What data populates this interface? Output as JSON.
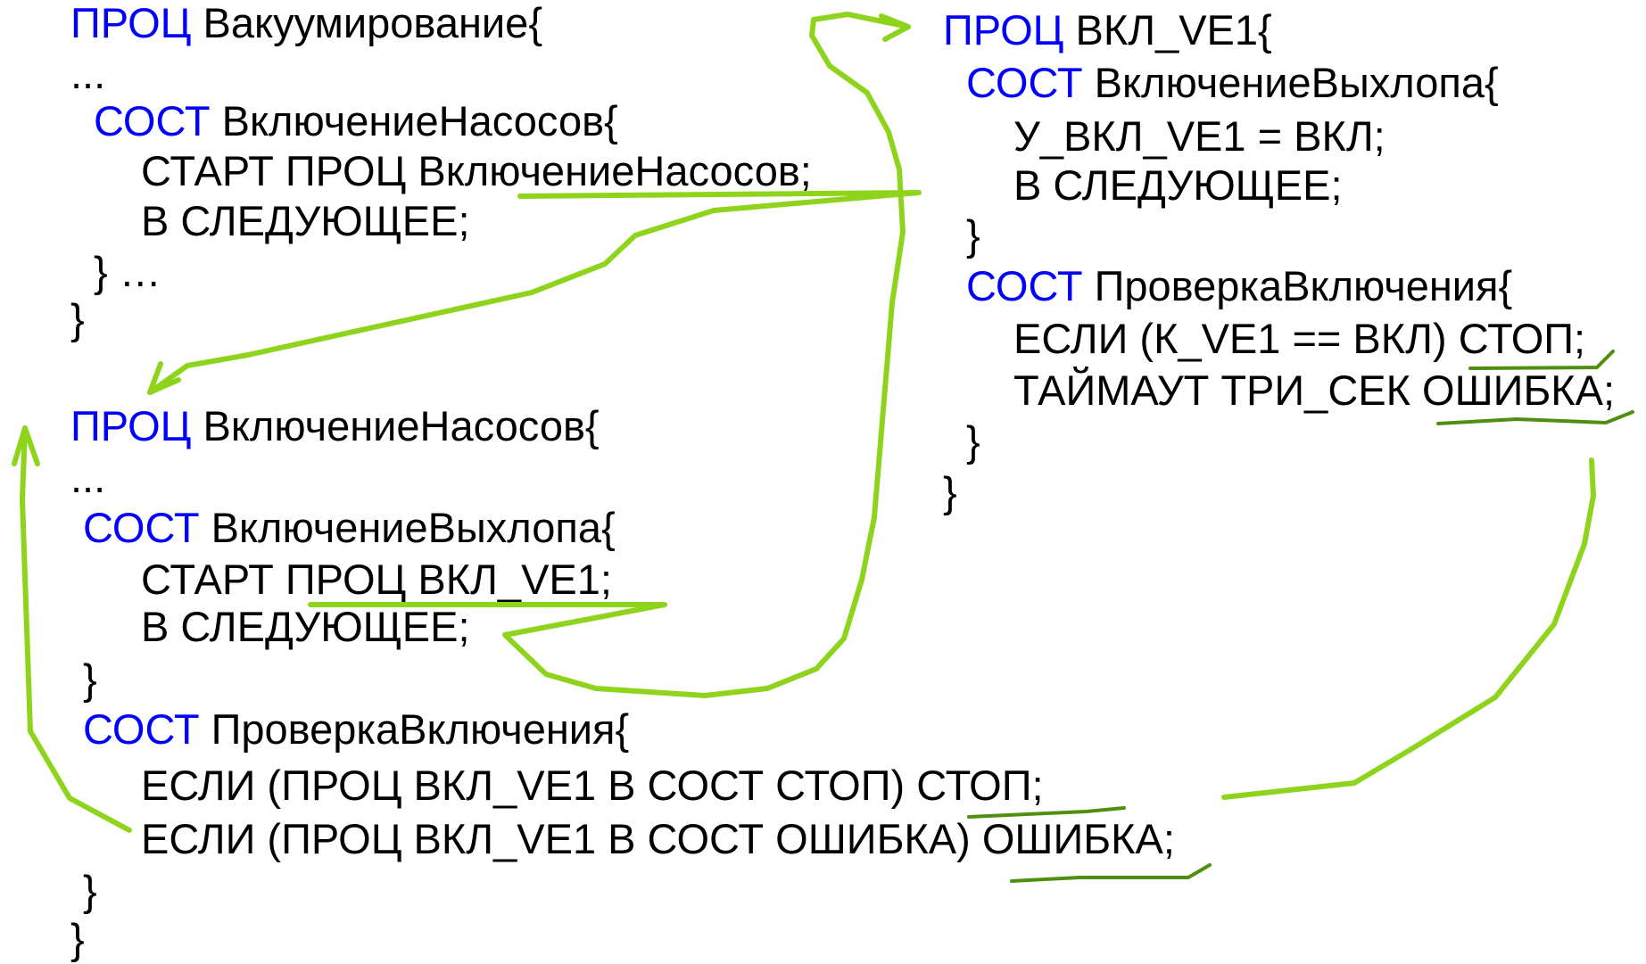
{
  "colors": {
    "keyword": "#0000ff",
    "text": "#000000",
    "arrow": "#8fd41c",
    "underline": "#4f8f10",
    "background": "#ffffff"
  },
  "left_top": {
    "lines": [
      {
        "kw": "ПРОЦ",
        "text": " Вакуумирование{"
      },
      {
        "kw": "",
        "text": "..."
      },
      {
        "kw": "СОСТ",
        "text": " ВключениеНасосов{"
      },
      {
        "kw": "",
        "text": "СТАРТ ПРОЦ ВключениеНасосов;"
      },
      {
        "kw": "",
        "text": "В СЛЕДУЮЩЕЕ;"
      },
      {
        "kw": "",
        "text": "} …"
      },
      {
        "kw": "",
        "text": "}"
      }
    ]
  },
  "left_bottom": {
    "lines": [
      {
        "kw": "ПРОЦ",
        "text": " ВключениеНасосов{"
      },
      {
        "kw": "",
        "text": "..."
      },
      {
        "kw": "СОСТ",
        "text": " ВключениеВыхлопа{"
      },
      {
        "kw": "",
        "text": "СТАРТ ПРОЦ ВКЛ_VE1;"
      },
      {
        "kw": "",
        "text": "В СЛЕДУЮЩЕЕ;"
      },
      {
        "kw": "",
        "text": "}"
      },
      {
        "kw": "СОСТ",
        "text": " ПроверкаВключения{"
      },
      {
        "kw": "",
        "text": "ЕСЛИ (ПРОЦ ВКЛ_VE1 В СОСТ СТОП) СТОП;"
      },
      {
        "kw": "",
        "text": "ЕСЛИ (ПРОЦ ВКЛ_VE1 В СОСТ ОШИБКА) ОШИБКА;"
      },
      {
        "kw": "",
        "text": "}"
      },
      {
        "kw": "",
        "text": "}"
      }
    ]
  },
  "right": {
    "lines": [
      {
        "kw": "ПРОЦ",
        "text": " ВКЛ_VE1{"
      },
      {
        "kw": "СОСТ",
        "text": " ВключениеВыхлопа{"
      },
      {
        "kw": "",
        "text": "У_ВКЛ_VE1 = ВКЛ;"
      },
      {
        "kw": "",
        "text": "В СЛЕДУЮЩЕЕ;"
      },
      {
        "kw": "",
        "text": "}"
      },
      {
        "kw": "СОСТ",
        "text": " ПроверкаВключения{"
      },
      {
        "kw": "",
        "text": "ЕСЛИ (К_VE1 == ВКЛ) СТОП;"
      },
      {
        "kw": "",
        "text": "ТАЙМАУТ ТРИ_СЕК ОШИБКА;"
      },
      {
        "kw": "",
        "text": "}"
      },
      {
        "kw": "",
        "text": "}"
      }
    ]
  }
}
